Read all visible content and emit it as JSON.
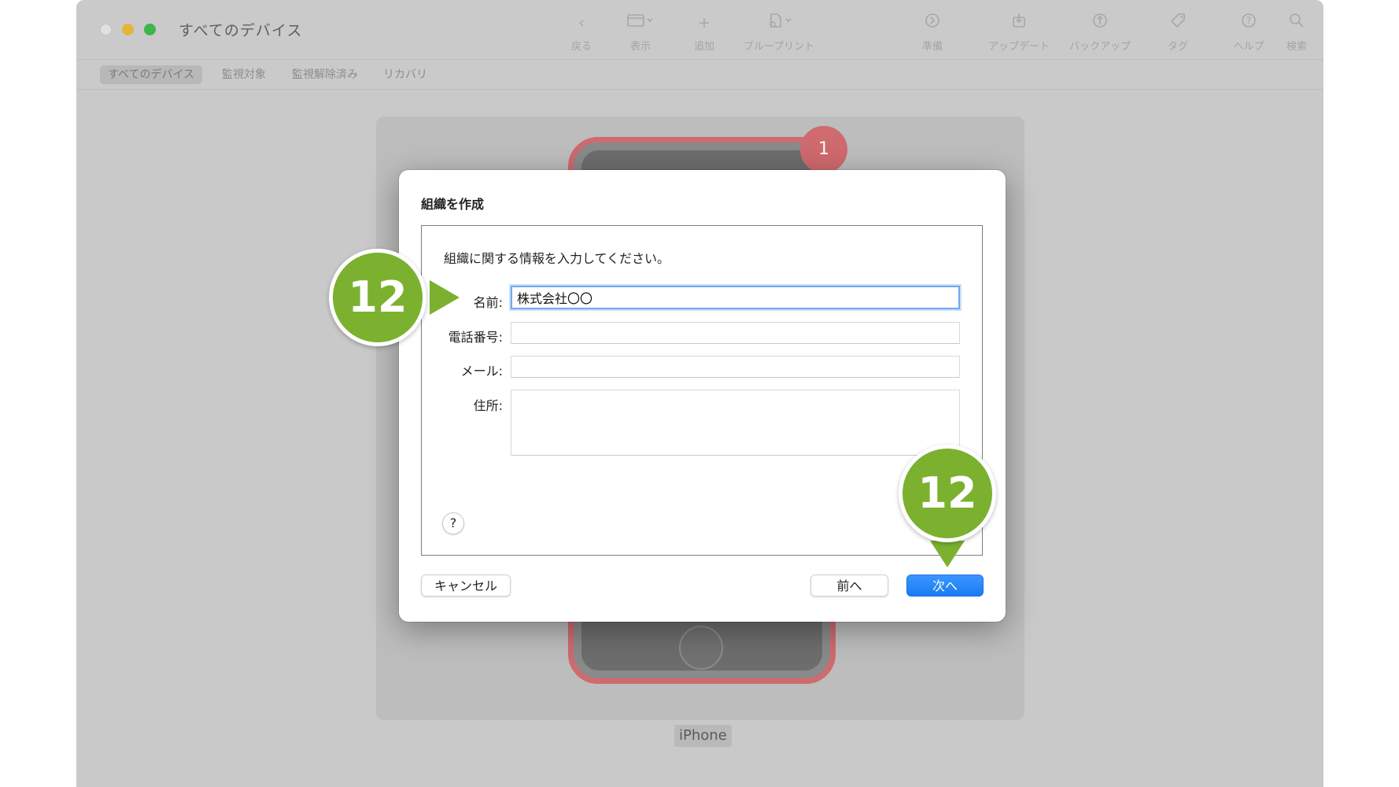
{
  "window": {
    "title": "すべてのデバイス",
    "toolbar": [
      {
        "label": "戻る",
        "icon": "back-chevron-icon"
      },
      {
        "label": "表示",
        "icon": "view-icon"
      },
      {
        "label": "追加",
        "icon": "add-icon"
      },
      {
        "label": "ブループリント",
        "icon": "blueprint-icon"
      },
      {
        "label": "準備",
        "icon": "prepare-icon"
      },
      {
        "label": "アップデート",
        "icon": "update-icon"
      },
      {
        "label": "バックアップ",
        "icon": "backup-icon"
      },
      {
        "label": "タグ",
        "icon": "tag-icon"
      },
      {
        "label": "ヘルプ",
        "icon": "help-icon"
      },
      {
        "label": "検索",
        "icon": "search-icon"
      }
    ],
    "segments": [
      "すべてのデバイス",
      "監視対象",
      "監視解除済み",
      "リカバリ"
    ],
    "active_segment": "すべてのデバイス"
  },
  "device": {
    "label": "iPhone",
    "badge": "1"
  },
  "dialog": {
    "title": "組織を作成",
    "instruction": "組織に関する情報を入力してください。",
    "fields": {
      "name": {
        "label": "名前:",
        "value": "株式会社〇〇"
      },
      "phone": {
        "label": "電話番号:",
        "value": ""
      },
      "email": {
        "label": "メール:",
        "value": ""
      },
      "address": {
        "label": "住所:",
        "value": ""
      }
    },
    "help": "?",
    "buttons": {
      "cancel": "キャンセル",
      "back": "前へ",
      "next": "次へ"
    }
  },
  "callouts": {
    "left": "12",
    "right": "12"
  },
  "colors": {
    "accent_blue": "#1a7cf2",
    "callout_green": "#7bb12f",
    "badge_red": "#cf6a6e",
    "focus_ring": "#6ea9ee"
  }
}
